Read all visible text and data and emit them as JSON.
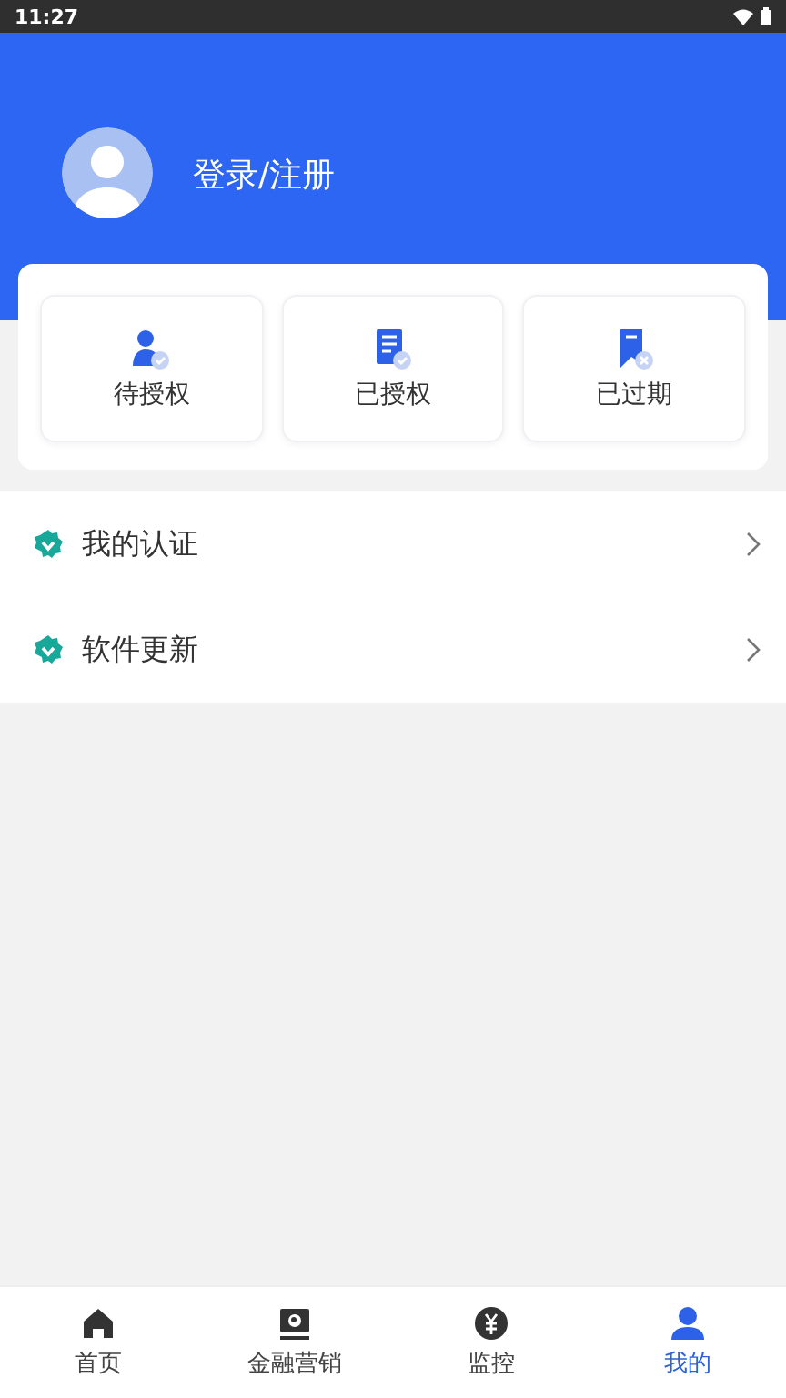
{
  "status_bar": {
    "time": "11:27"
  },
  "profile": {
    "login_label": "登录/注册"
  },
  "auth_tiles": [
    {
      "kind": "pending",
      "label": "待授权"
    },
    {
      "kind": "granted",
      "label": "已授权"
    },
    {
      "kind": "expired",
      "label": "已过期"
    }
  ],
  "menu": [
    {
      "label": "我的认证"
    },
    {
      "label": "软件更新"
    }
  ],
  "bottom_nav": [
    {
      "kind": "home",
      "label": "首页",
      "selected": false
    },
    {
      "kind": "screen",
      "label": "金融营销",
      "selected": false
    },
    {
      "kind": "coin",
      "label": "监控",
      "selected": false
    },
    {
      "kind": "person",
      "label": "我的",
      "selected": true
    }
  ]
}
